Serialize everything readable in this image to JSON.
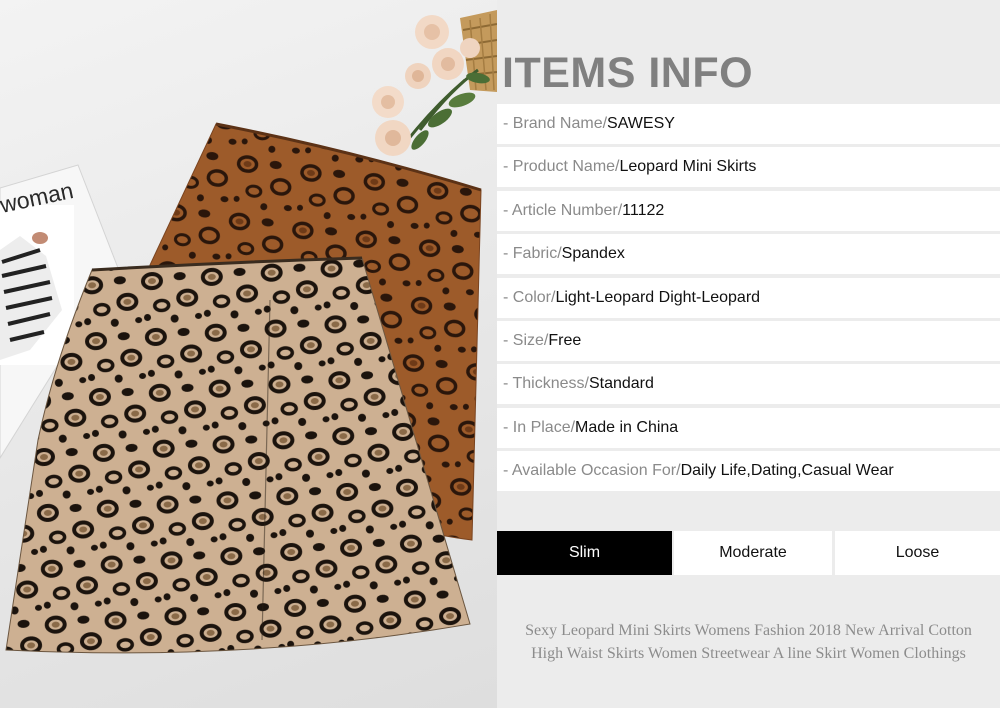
{
  "photo": {
    "magazine_text": "woman"
  },
  "info": {
    "title": "ITEMS INFO",
    "rows": [
      {
        "label": "- Brand Name/ ",
        "value": "SAWESY"
      },
      {
        "label": "- Product Name/",
        "value": "Leopard Mini Skirts"
      },
      {
        "label": "- Article Number/ ",
        "value": "11122"
      },
      {
        "label": "- Fabric/ ",
        "value": "Spandex"
      },
      {
        "label": "- Color/ ",
        "value": "Light-Leopard Dight-Leopard"
      },
      {
        "label": "- Size/ ",
        "value": "Free"
      },
      {
        "label": "- Thickness/ ",
        "value": "Standard"
      },
      {
        "label": "- In Place/ ",
        "value": "Made in China"
      },
      {
        "label": "- Available Occasion For/ ",
        "value": "Daily Life,Dating,Casual Wear"
      }
    ],
    "fit_options": [
      "Slim",
      "Moderate",
      "Loose"
    ],
    "fit_selected": "Slim",
    "description_line1": "Sexy Leopard Mini Skirts Womens Fashion 2018 New Arrival Cotton",
    "description_line2": "High Waist Skirts Women Streetwear A line Skirt Women Clothings"
  },
  "colors": {
    "title_gray": "#808080",
    "panel_bg": "#ececec",
    "selected_bg": "#000000",
    "dark_skirt": "#9a5a2a",
    "light_skirt": "#c9ad8c"
  }
}
